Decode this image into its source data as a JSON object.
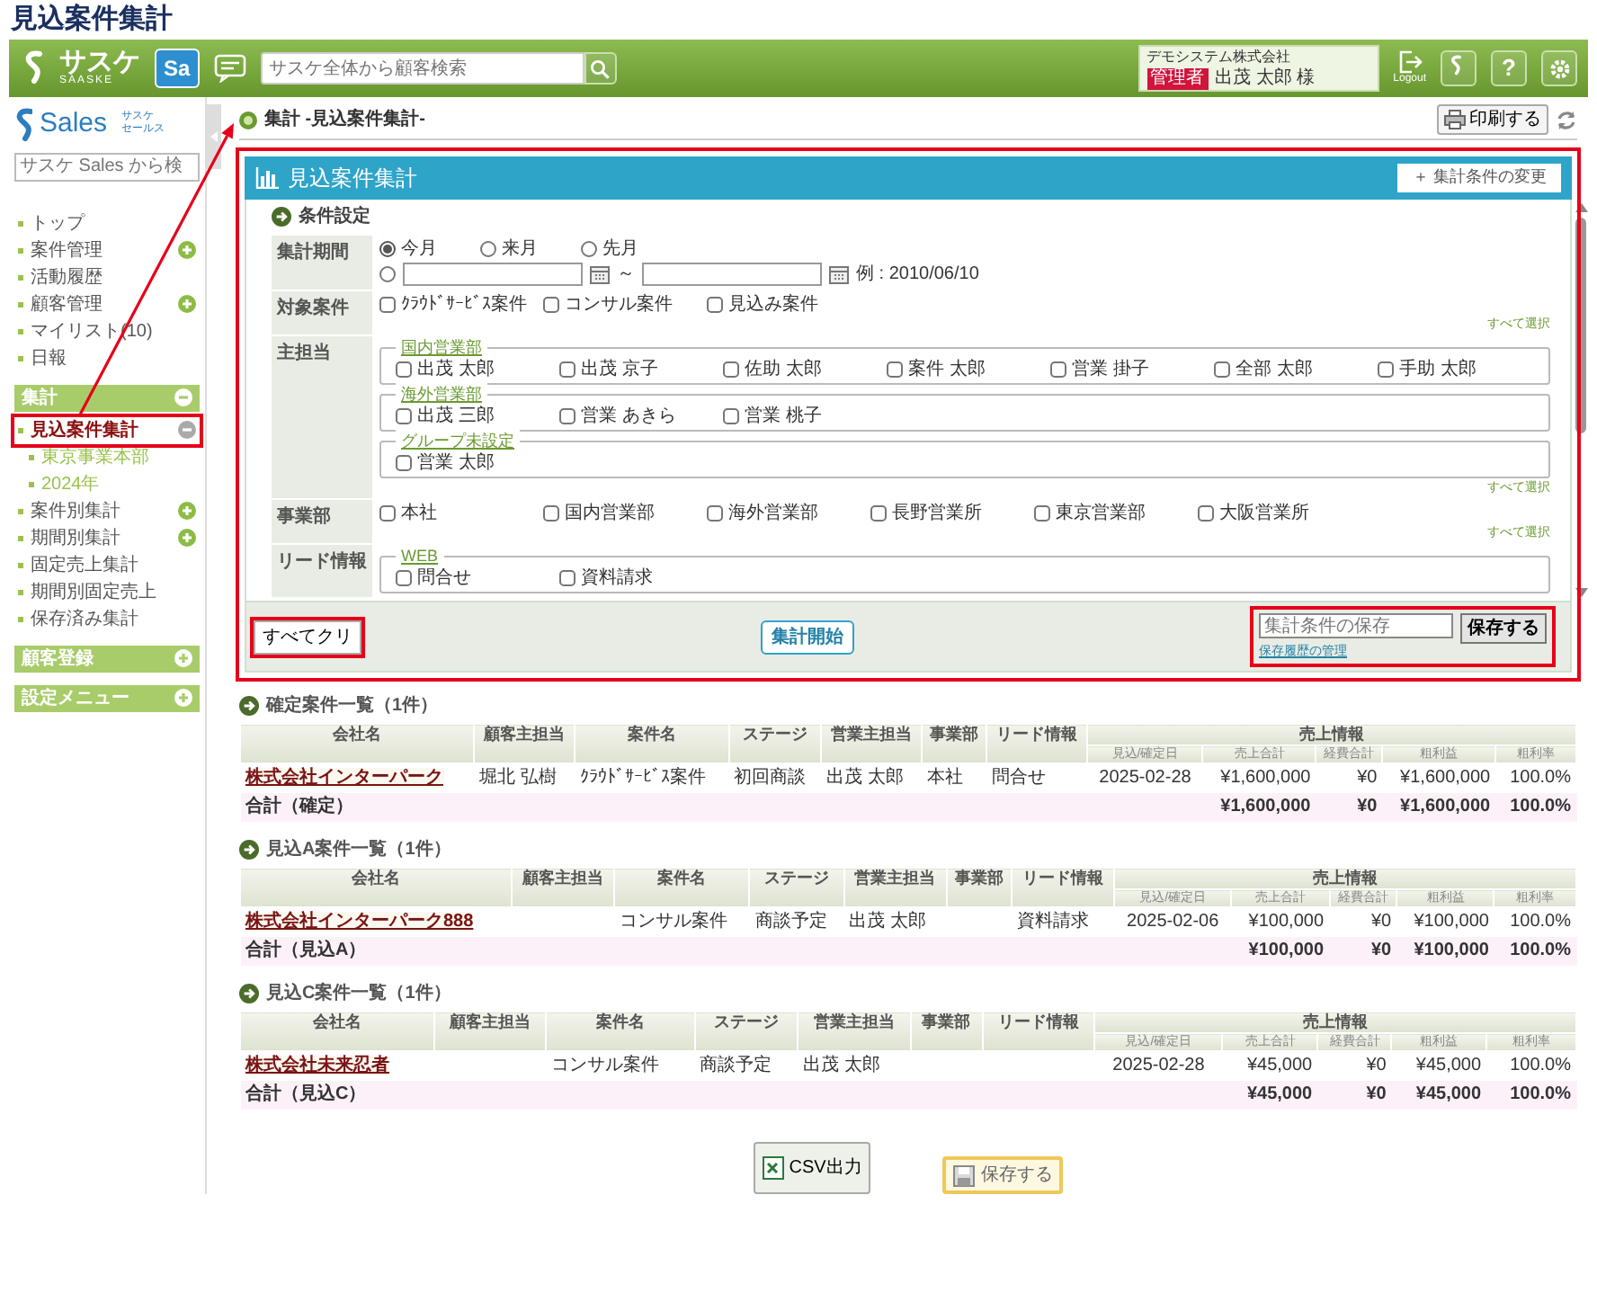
{
  "page_title": "見込案件集計",
  "header": {
    "logo": "サスケ",
    "logo_sub": "SAASKE",
    "app_badge": "Sa",
    "search": {
      "placeholder": "サスケ全体から顧客検索"
    },
    "company": "デモシステム株式会社",
    "role_badge": "管理者",
    "user": "出茂 太郎 様",
    "logout": "Logout",
    "help": "?"
  },
  "sidebar": {
    "logo": "Sales",
    "logo_sub": [
      "サスケ",
      "セールス"
    ],
    "search": {
      "placeholder": "サスケ Sales から検"
    },
    "items": [
      {
        "label": "トップ",
        "selected": false
      },
      {
        "label": "案件管理",
        "selected": false,
        "expanded": false
      },
      {
        "label": "活動履歴",
        "selected": false
      },
      {
        "label": "顧客管理",
        "selected": false,
        "expanded": false
      },
      {
        "label": "マイリスト(10)",
        "selected": false
      },
      {
        "label": "日報",
        "selected": false
      }
    ],
    "sections": [
      {
        "title": "集計",
        "expanded": true,
        "items": [
          {
            "label": "見込案件集計",
            "selected": true,
            "highlighted": true,
            "expanded": true,
            "children": [
              {
                "label": "東京事業本部"
              },
              {
                "label": "2024年"
              }
            ]
          },
          {
            "label": "案件別集計",
            "selected": false,
            "highlighted": false,
            "expanded": false
          },
          {
            "label": "期間別集計",
            "selected": false,
            "highlighted": false,
            "expanded": false
          },
          {
            "label": "固定売上集計",
            "selected": false,
            "highlighted": false
          },
          {
            "label": "期間別固定売上",
            "selected": false,
            "highlighted": false
          },
          {
            "label": "保存済み集計",
            "selected": false,
            "highlighted": false
          }
        ]
      },
      {
        "title": "顧客登録",
        "expanded": false
      },
      {
        "title": "設定メニュー",
        "expanded": false
      }
    ]
  },
  "annotation_arrow": true,
  "breadcrumb": "集計 -見込案件集計-",
  "print_button": "印刷する",
  "panel": {
    "title": "見込案件集計",
    "highlighted": true,
    "change_button": "＋ 集計条件の変更",
    "section_title": "条件設定",
    "rows": [
      {
        "label": "集計期間",
        "kind": "period",
        "options": [
          {
            "label": "今月",
            "selected": true
          },
          {
            "label": "来月",
            "selected": false
          },
          {
            "label": "先月",
            "selected": false
          }
        ],
        "custom_selected": false,
        "separator": "～",
        "example": "例 : 2010/06/10"
      },
      {
        "label": "対象案件",
        "kind": "checks",
        "options": [
          {
            "label": "ｸﾗｳﾄﾞｻｰﾋﾞｽ案件",
            "checked": false
          },
          {
            "label": "コンサル案件",
            "checked": false
          },
          {
            "label": "見込み案件",
            "checked": false
          }
        ],
        "select_all": "すべて選択"
      },
      {
        "label": "主担当",
        "kind": "groups",
        "groups": [
          {
            "name": "国内営業部",
            "options": [
              {
                "label": "出茂 太郎",
                "checked": false
              },
              {
                "label": "出茂 京子",
                "checked": false
              },
              {
                "label": "佐助 太郎",
                "checked": false
              },
              {
                "label": "案件 太郎",
                "checked": false
              },
              {
                "label": "営業 掛子",
                "checked": false
              },
              {
                "label": "全部 太郎",
                "checked": false
              },
              {
                "label": "手助 太郎",
                "checked": false
              }
            ]
          },
          {
            "name": "海外営業部",
            "options": [
              {
                "label": "出茂 三郎",
                "checked": false
              },
              {
                "label": "営業 あきら",
                "checked": false
              },
              {
                "label": "営業 桃子",
                "checked": false
              }
            ]
          },
          {
            "name": "グループ未設定",
            "options": [
              {
                "label": "営業 太郎",
                "checked": false
              }
            ]
          }
        ],
        "select_all": "すべて選択"
      },
      {
        "label": "事業部",
        "kind": "checks",
        "options": [
          {
            "label": "本社",
            "checked": false
          },
          {
            "label": "国内営業部",
            "checked": false
          },
          {
            "label": "海外営業部",
            "checked": false
          },
          {
            "label": "長野営業所",
            "checked": false
          },
          {
            "label": "東京営業部",
            "checked": false
          },
          {
            "label": "大阪営業所",
            "checked": false
          }
        ],
        "select_all": "すべて選択"
      },
      {
        "label": "リード情報",
        "kind": "groups",
        "groups": [
          {
            "name": "WEB",
            "options": [
              {
                "label": "問合せ",
                "checked": false
              },
              {
                "label": "資料請求",
                "checked": false
              }
            ]
          }
        ]
      }
    ],
    "footer": {
      "clear_button": "すべてクリ",
      "clear_highlighted": true,
      "start_button": "集計開始",
      "save": {
        "placeholder": "集計条件の保存",
        "button": "保存する",
        "link": "保存履歴の管理",
        "highlighted": true
      }
    }
  },
  "tables": [
    {
      "title": "確定案件一覧（1件）",
      "columns": [
        "会社名",
        "顧客主担当",
        "案件名",
        "ステージ",
        "営業主担当",
        "事業部",
        "リード情報"
      ],
      "group_header": "売上情報",
      "sub_columns": [
        "見込/確定日",
        "売上合計",
        "経費合計",
        "粗利益",
        "粗利率"
      ],
      "rows": [
        [
          "株式会社インターパーク",
          "堀北 弘樹",
          "ｸﾗｳﾄﾞｻｰﾋﾞｽ案件",
          "初回商談",
          "出茂 太郎",
          "本社",
          "問合せ",
          "2025-02-28",
          "¥1,600,000",
          "¥0",
          "¥1,600,000",
          "100.0%"
        ]
      ],
      "total": {
        "label": "合計（確定）",
        "values": [
          "¥1,600,000",
          "¥0",
          "¥1,600,000",
          "100.0%"
        ]
      }
    },
    {
      "title": "見込A案件一覧（1件）",
      "columns": [
        "会社名",
        "顧客主担当",
        "案件名",
        "ステージ",
        "営業主担当",
        "事業部",
        "リード情報"
      ],
      "group_header": "売上情報",
      "sub_columns": [
        "見込/確定日",
        "売上合計",
        "経費合計",
        "粗利益",
        "粗利率"
      ],
      "rows": [
        [
          "株式会社インターパーク888",
          null,
          "コンサル案件",
          "商談予定",
          "出茂 太郎",
          null,
          "資料請求",
          "2025-02-06",
          "¥100,000",
          "¥0",
          "¥100,000",
          "100.0%"
        ]
      ],
      "total": {
        "label": "合計（見込A）",
        "values": [
          "¥100,000",
          "¥0",
          "¥100,000",
          "100.0%"
        ]
      }
    },
    {
      "title": "見込C案件一覧（1件）",
      "columns": [
        "会社名",
        "顧客主担当",
        "案件名",
        "ステージ",
        "営業主担当",
        "事業部",
        "リード情報"
      ],
      "group_header": "売上情報",
      "sub_columns": [
        "見込/確定日",
        "売上合計",
        "経費合計",
        "粗利益",
        "粗利率"
      ],
      "rows": [
        [
          "株式会社未来忍者",
          null,
          "コンサル案件",
          "商談予定",
          "出茂 太郎",
          null,
          null,
          "2025-02-28",
          "¥45,000",
          "¥0",
          "¥45,000",
          "100.0%"
        ]
      ],
      "total": {
        "label": "合計（見込C）",
        "values": [
          "¥45,000",
          "¥0",
          "¥45,000",
          "100.0%"
        ]
      }
    }
  ],
  "buttons": [
    {
      "kind": "csv",
      "label": "CSV出力"
    },
    {
      "kind": "save",
      "label": "保存する"
    }
  ]
}
